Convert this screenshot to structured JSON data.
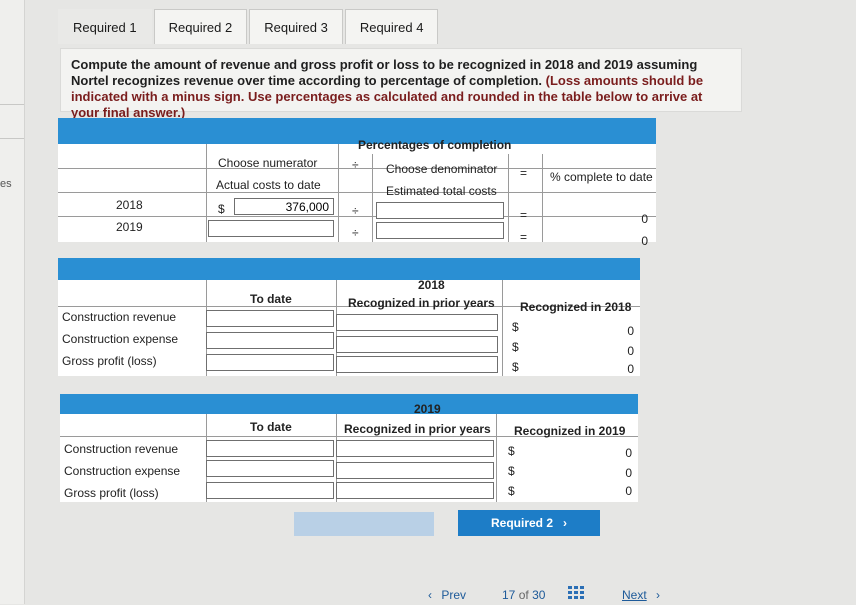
{
  "sidebar": {
    "partial_label": "es"
  },
  "tabs": [
    {
      "label": "Required 1"
    },
    {
      "label": "Required 2"
    },
    {
      "label": "Required 3"
    },
    {
      "label": "Required 4"
    }
  ],
  "instructions": {
    "text": "Compute the amount of revenue and gross profit or loss to be recognized in 2018 and 2019 assuming Nortel recognizes revenue over time according to percentage of completion.",
    "hint": "(Loss amounts should be indicated with a minus sign. Use percentages as calculated and rounded in the table below to arrive at your final answer.)"
  },
  "completion_table": {
    "title": "Percentages of completion",
    "numerator_header": "Choose numerator",
    "divide_symbol": "÷",
    "denominator_header": "Choose denominator",
    "equals_symbol": "=",
    "result_header": "% complete to date",
    "numerator_label": "Actual costs to date",
    "denominator_label": "Estimated total costs",
    "rows": [
      {
        "year": "2018",
        "currency": "$",
        "numerator": "376,000",
        "divide": "÷",
        "equals": "=",
        "result": "0"
      },
      {
        "year": "2019",
        "currency": "",
        "numerator": "",
        "divide": "÷",
        "equals": "=",
        "result": "0"
      }
    ]
  },
  "table_2018": {
    "year": "2018",
    "col_to_date": "To date",
    "col_prior": "Recognized in prior years",
    "col_current": "Recognized in 2018",
    "rows": [
      {
        "label": "Construction revenue",
        "currency": "$",
        "value": "0"
      },
      {
        "label": "Construction expense",
        "currency": "$",
        "value": "0"
      },
      {
        "label": "Gross profit (loss)",
        "currency": "$",
        "value": "0"
      }
    ]
  },
  "table_2019": {
    "year": "2019",
    "col_to_date": "To date",
    "col_prior": "Recognized in prior years",
    "col_current": "Recognized in 2019",
    "rows": [
      {
        "label": "Construction revenue",
        "currency": "$",
        "value": "0"
      },
      {
        "label": "Construction expense",
        "currency": "$",
        "value": "0"
      },
      {
        "label": "Gross profit (loss)",
        "currency": "$",
        "value": "0"
      }
    ]
  },
  "footer": {
    "next_required_label": "Required 2",
    "next_required_arrow": "›",
    "prev_arrow": "‹",
    "prev_label": "Prev",
    "page_current": "17",
    "page_of": "of",
    "page_total": "30",
    "next_label": "Next",
    "next_arrow": "›"
  }
}
